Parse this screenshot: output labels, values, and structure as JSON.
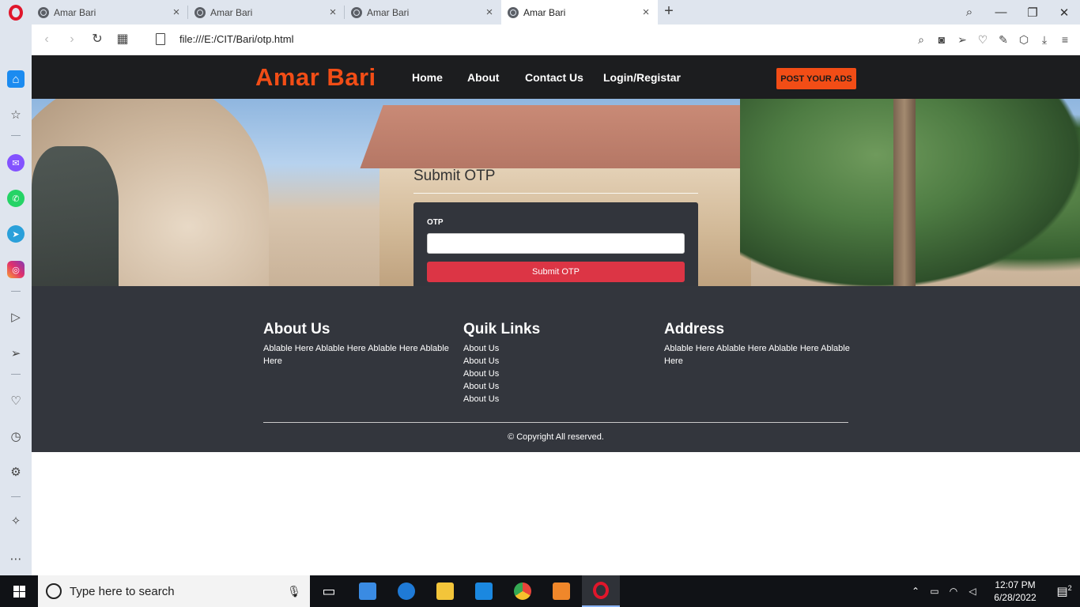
{
  "browser": {
    "tabs": [
      {
        "title": "Amar Bari",
        "close": "×"
      },
      {
        "title": "Amar Bari",
        "close": "×"
      },
      {
        "title": "Amar Bari",
        "close": "×"
      },
      {
        "title": "Amar Bari",
        "close": "×"
      }
    ],
    "new_tab": "+",
    "url": "file:///E:/CIT/Bari/otp.html",
    "nav": {
      "back": "‹",
      "forward": "›",
      "reload": "↻",
      "tabs_grid": "▦"
    },
    "window_controls": {
      "search": "⌕",
      "minimize": "—",
      "restore": "❐",
      "close": "✕"
    },
    "toolbar_icons": {
      "zoom": "⌕",
      "snapshot": "◙",
      "send": "➢",
      "favorite": "♡",
      "picker": "✎",
      "extensions": "⬡",
      "download": "⤓",
      "menu": "≡"
    }
  },
  "sidebar": {
    "items": [
      {
        "name": "home",
        "glyph": "⌂"
      },
      {
        "name": "bookmarks",
        "glyph": "☆"
      },
      {
        "name": "messenger",
        "glyph": "✉"
      },
      {
        "name": "whatsapp",
        "glyph": "✆"
      },
      {
        "name": "telegram",
        "glyph": "➤"
      },
      {
        "name": "instagram",
        "glyph": "◎"
      },
      {
        "name": "player",
        "glyph": "▷"
      },
      {
        "name": "send",
        "glyph": "➢"
      },
      {
        "name": "favorites",
        "glyph": "♡"
      },
      {
        "name": "history",
        "glyph": "◷"
      },
      {
        "name": "settings",
        "glyph": "⚙"
      },
      {
        "name": "tips",
        "glyph": "✧"
      },
      {
        "name": "more",
        "glyph": "⋯"
      }
    ]
  },
  "site": {
    "brand": "Amar Bari",
    "nav": [
      "Home",
      "About",
      "Contact Us",
      "Login/Registar"
    ],
    "post_button": "POST YOUR ADS",
    "otp": {
      "title": "Submit OTP",
      "label": "OTP",
      "input_value": "",
      "submit": "Submit OTP"
    },
    "footer": {
      "about": {
        "title": "About Us",
        "text": "Ablable Here Ablable Here Ablable Here Ablable Here"
      },
      "links": {
        "title": "Quik Links",
        "items": [
          "About Us",
          "About Us",
          "About Us",
          "About Us",
          "About Us"
        ]
      },
      "address": {
        "title": "Address",
        "text": "Ablable Here Ablable Here Ablable Here Ablable Here"
      },
      "copyright": "© Copyright All reserved."
    }
  },
  "taskbar": {
    "search_placeholder": "Type here to search",
    "time": "12:07 PM",
    "date": "6/28/2022",
    "notification_count": "2",
    "apps": [
      "task-view",
      "store",
      "edge",
      "file-explorer",
      "mail",
      "chrome",
      "sublime-text",
      "opera"
    ],
    "colors": {
      "edge": "#1f7ad6",
      "explorer": "#f3c53a",
      "mail": "#1b88e0",
      "chrome": "#e9443a",
      "sublime": "#f0872a",
      "opera": "#e0162b",
      "store": "#3a8be3"
    }
  },
  "colors": {
    "brand": "#f24d16",
    "header_bg": "#1c1d1f",
    "card_bg": "#32353c",
    "submit": "#dc3545",
    "footer_bg": "#33363d"
  }
}
